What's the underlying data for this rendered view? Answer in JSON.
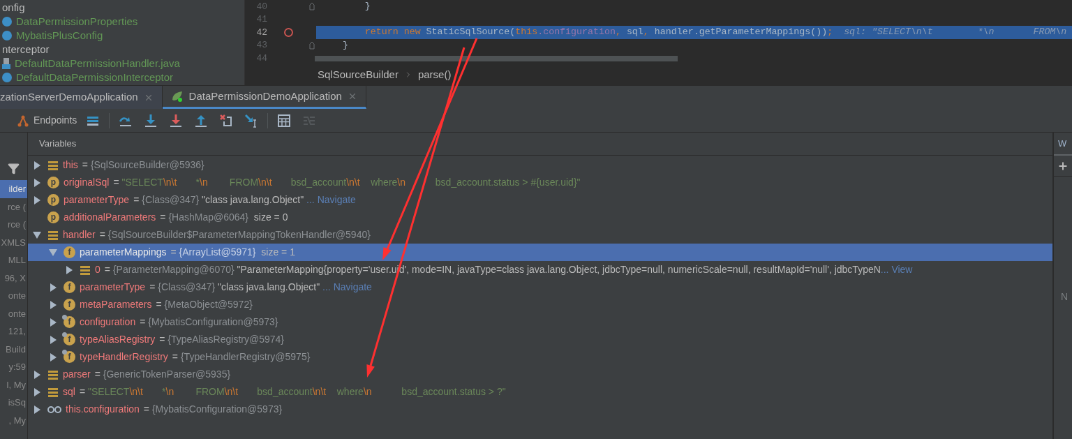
{
  "project_tree": {
    "items": [
      {
        "label": "onfig",
        "kind": "folder",
        "color": "#bbbbbb"
      },
      {
        "label": "DataPermissionProperties",
        "kind": "class",
        "color": "#629755"
      },
      {
        "label": "MybatisPlusConfig",
        "kind": "class",
        "color": "#629755"
      },
      {
        "label": "nterceptor",
        "kind": "folder",
        "color": "#bbbbbb"
      },
      {
        "label": "DefaultDataPermissionHandler.java",
        "kind": "file",
        "color": "#629755"
      },
      {
        "label": "DefaultDataPermissionInterceptor",
        "kind": "class",
        "color": "#629755"
      }
    ]
  },
  "editor": {
    "lines": [
      {
        "number": "40",
        "breakpoint": false,
        "current": false,
        "fold": true,
        "tokens": [
          {
            "kind": "plain",
            "text": "        }"
          }
        ]
      },
      {
        "number": "41",
        "breakpoint": false,
        "current": false,
        "fold": false
      },
      {
        "number": "42",
        "breakpoint": true,
        "current": true,
        "fold": false,
        "tokens": [
          {
            "kind": "keyword",
            "text": "        return new "
          },
          {
            "kind": "plain",
            "text": "StaticSqlSource("
          },
          {
            "kind": "keyword",
            "text": "this"
          },
          {
            "kind": "field",
            "text": ".configuration"
          },
          {
            "kind": "keyword",
            "text": ", "
          },
          {
            "kind": "plain",
            "text": "sql"
          },
          {
            "kind": "keyword",
            "text": ", "
          },
          {
            "kind": "plain",
            "text": "handler.getParameterMappings())"
          },
          {
            "kind": "keyword",
            "text": ";"
          },
          {
            "kind": "inline",
            "text": "  sql: \"SELECT\\n\\t        *\\n       FROM\\n"
          }
        ]
      },
      {
        "number": "43",
        "breakpoint": false,
        "current": false,
        "fold": true,
        "tokens": [
          {
            "kind": "plain",
            "text": "    }"
          }
        ]
      },
      {
        "number": "44",
        "breakpoint": false,
        "current": false,
        "fold": false
      }
    ],
    "breadcrumb": [
      "SqlSourceBuilder",
      "parse()"
    ]
  },
  "run_tabs": [
    {
      "label": "zationServerDemoApplication",
      "kind": "plain",
      "selected": false
    },
    {
      "label": "DataPermissionDemoApplication",
      "kind": "spring",
      "selected": true
    }
  ],
  "toolbar": {
    "endpoints_label": "Endpoints",
    "buttons": [
      {
        "kind": "list",
        "disabled": false
      },
      {
        "kind": "step-over",
        "disabled": false
      },
      {
        "kind": "step-into",
        "disabled": false
      },
      {
        "kind": "force-step-into",
        "disabled": false
      },
      {
        "kind": "step-out",
        "disabled": false
      },
      {
        "kind": "drop-frame",
        "disabled": false
      },
      {
        "kind": "run-to-cursor",
        "disabled": false
      },
      {
        "kind": "evaluate",
        "disabled": false
      },
      {
        "kind": "trace",
        "disabled": true
      }
    ]
  },
  "frames": [
    {
      "label": "ilder",
      "selected": true
    },
    {
      "label": "rce (",
      "selected": false
    },
    {
      "label": "rce (",
      "selected": false
    },
    {
      "label": "XMLS",
      "selected": false
    },
    {
      "label": "MLL",
      "selected": false
    },
    {
      "label": "96, X",
      "selected": false
    },
    {
      "label": "onte",
      "selected": false
    },
    {
      "label": "onte",
      "selected": false
    },
    {
      "label": "121,",
      "selected": false
    },
    {
      "label": "Build",
      "selected": false
    },
    {
      "label": "y:59",
      "selected": false
    },
    {
      "label": "l, My",
      "selected": false
    },
    {
      "label": "isSq",
      "selected": false
    },
    {
      "label": ", My",
      "selected": false
    }
  ],
  "variables": {
    "title": "Variables",
    "rows": [
      {
        "name": "this",
        "kind": "object",
        "pinned": false,
        "leaf": false,
        "expanded": false,
        "selected": false,
        "value": [
          {
            "kind": "plain",
            "text": "= "
          },
          {
            "kind": "type",
            "text": "{SqlSourceBuilder@5936}"
          }
        ]
      },
      {
        "name": "originalSql",
        "kind": "badge",
        "letter": "p",
        "pinned": false,
        "leaf": false,
        "expanded": false,
        "selected": false,
        "value": [
          {
            "kind": "plain",
            "text": "= "
          },
          {
            "kind": "str",
            "text": "\"SELECT"
          },
          {
            "kind": "esc",
            "text": "\\n\\t"
          },
          {
            "kind": "str",
            "text": "       *"
          },
          {
            "kind": "esc",
            "text": "\\n"
          },
          {
            "kind": "str",
            "text": "        FROM"
          },
          {
            "kind": "esc",
            "text": "\\n\\t"
          },
          {
            "kind": "str",
            "text": "       bsd_account"
          },
          {
            "kind": "esc",
            "text": "\\n\\t"
          },
          {
            "kind": "str",
            "text": "    where"
          },
          {
            "kind": "esc",
            "text": "\\n"
          },
          {
            "kind": "str",
            "text": "           bsd_account.status > #{user.uid}\""
          }
        ]
      },
      {
        "name": "parameterType",
        "kind": "badge",
        "letter": "p",
        "pinned": false,
        "leaf": false,
        "expanded": false,
        "selected": false,
        "value": [
          {
            "kind": "plain",
            "text": "= "
          },
          {
            "kind": "type",
            "text": "{Class@347}"
          },
          {
            "kind": "plain",
            "text": " \"class java.lang.Object\""
          },
          {
            "kind": "link",
            "text": " ... Navigate"
          }
        ]
      },
      {
        "name": "additionalParameters",
        "kind": "badge",
        "letter": "p",
        "pinned": false,
        "leaf": true,
        "expanded": false,
        "selected": false,
        "value": [
          {
            "kind": "plain",
            "text": "= "
          },
          {
            "kind": "type",
            "text": "{HashMap@6064}"
          },
          {
            "kind": "plain",
            "text": "  size = 0"
          }
        ]
      },
      {
        "name": "handler",
        "kind": "object",
        "pinned": false,
        "leaf": false,
        "expanded": true,
        "selected": false,
        "value": [
          {
            "kind": "plain",
            "text": "= "
          },
          {
            "kind": "type",
            "text": "{SqlSourceBuilder$ParameterMappingTokenHandler@5940}"
          }
        ],
        "children": [
          {
            "name": "parameterMappings",
            "kind": "badge",
            "letter": "f",
            "pinned": false,
            "leaf": false,
            "expanded": true,
            "selected": true,
            "value": [
              {
                "kind": "plain",
                "text": "= "
              },
              {
                "kind": "type",
                "text": "{ArrayList@5971}"
              },
              {
                "kind": "plain",
                "text": "  size = 1"
              }
            ],
            "children": [
              {
                "name": "0",
                "kind": "object",
                "pinned": false,
                "leaf": false,
                "expanded": false,
                "selected": false,
                "value": [
                  {
                    "kind": "plain",
                    "text": "= "
                  },
                  {
                    "kind": "type",
                    "text": "{ParameterMapping@6070}"
                  },
                  {
                    "kind": "plain",
                    "text": " \"ParameterMapping{property='user.uid', mode=IN, javaType=class java.lang.Object, jdbcType=null, numericScale=null, resultMapId='null', jdbcTypeN"
                  },
                  {
                    "kind": "link",
                    "text": "... View"
                  }
                ]
              }
            ]
          },
          {
            "name": "parameterType",
            "kind": "badge",
            "letter": "f",
            "pinned": false,
            "leaf": false,
            "expanded": false,
            "selected": false,
            "value": [
              {
                "kind": "plain",
                "text": "= "
              },
              {
                "kind": "type",
                "text": "{Class@347}"
              },
              {
                "kind": "plain",
                "text": " \"class java.lang.Object\""
              },
              {
                "kind": "link",
                "text": " ... Navigate"
              }
            ]
          },
          {
            "name": "metaParameters",
            "kind": "badge",
            "letter": "f",
            "pinned": false,
            "leaf": false,
            "expanded": false,
            "selected": false,
            "value": [
              {
                "kind": "plain",
                "text": "= "
              },
              {
                "kind": "type",
                "text": "{MetaObject@5972}"
              }
            ]
          },
          {
            "name": "configuration",
            "kind": "badge",
            "letter": "f",
            "pinned": true,
            "leaf": false,
            "expanded": false,
            "selected": false,
            "value": [
              {
                "kind": "plain",
                "text": "= "
              },
              {
                "kind": "type",
                "text": "{MybatisConfiguration@5973}"
              }
            ]
          },
          {
            "name": "typeAliasRegistry",
            "kind": "badge",
            "letter": "f",
            "pinned": true,
            "leaf": false,
            "expanded": false,
            "selected": false,
            "value": [
              {
                "kind": "plain",
                "text": "= "
              },
              {
                "kind": "type",
                "text": "{TypeAliasRegistry@5974}"
              }
            ]
          },
          {
            "name": "typeHandlerRegistry",
            "kind": "badge",
            "letter": "f",
            "pinned": true,
            "leaf": false,
            "expanded": false,
            "selected": false,
            "value": [
              {
                "kind": "plain",
                "text": "= "
              },
              {
                "kind": "type",
                "text": "{TypeHandlerRegistry@5975}"
              }
            ]
          }
        ]
      },
      {
        "name": "parser",
        "kind": "object",
        "pinned": false,
        "leaf": false,
        "expanded": false,
        "selected": false,
        "value": [
          {
            "kind": "plain",
            "text": "= "
          },
          {
            "kind": "type",
            "text": "{GenericTokenParser@5935}"
          }
        ]
      },
      {
        "name": "sql",
        "kind": "object",
        "pinned": false,
        "leaf": false,
        "expanded": false,
        "selected": false,
        "value": [
          {
            "kind": "plain",
            "text": "= "
          },
          {
            "kind": "str",
            "text": "\"SELECT"
          },
          {
            "kind": "esc",
            "text": "\\n\\t"
          },
          {
            "kind": "str",
            "text": "       *"
          },
          {
            "kind": "esc",
            "text": "\\n"
          },
          {
            "kind": "str",
            "text": "        FROM"
          },
          {
            "kind": "esc",
            "text": "\\n\\t"
          },
          {
            "kind": "str",
            "text": "       bsd_account"
          },
          {
            "kind": "esc",
            "text": "\\n\\t"
          },
          {
            "kind": "str",
            "text": "    where"
          },
          {
            "kind": "esc",
            "text": "\\n"
          },
          {
            "kind": "str",
            "text": "           bsd_account.status > ?\""
          }
        ]
      },
      {
        "name": "this.configuration",
        "kind": "watch",
        "pinned": false,
        "leaf": false,
        "expanded": false,
        "selected": false,
        "value": [
          {
            "kind": "plain",
            "text": "= "
          },
          {
            "kind": "type",
            "text": "{MybatisConfiguration@5973}"
          }
        ]
      }
    ]
  },
  "watches": {
    "tab": "W",
    "note": "N"
  }
}
